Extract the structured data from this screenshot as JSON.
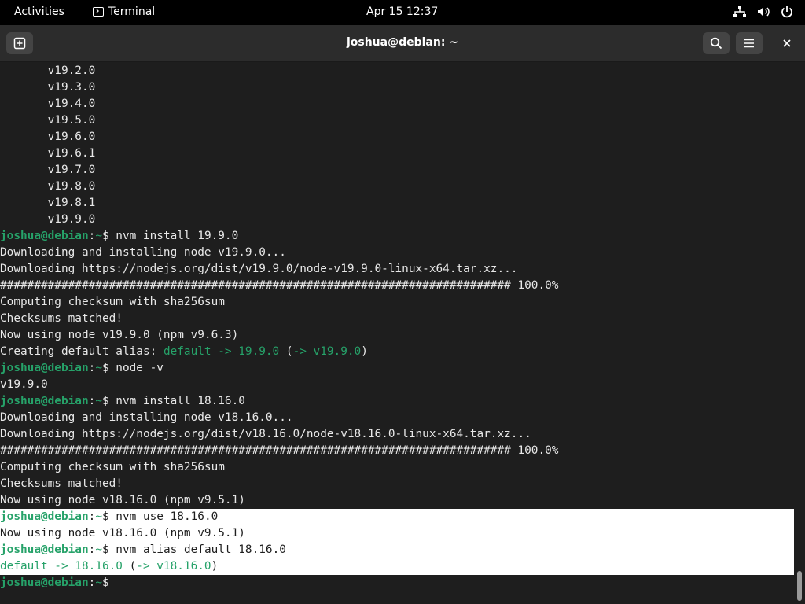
{
  "topbar": {
    "activities": "Activities",
    "app_name": "Terminal",
    "clock": "Apr 15  12:37"
  },
  "window": {
    "title": "joshua@debian: ~"
  },
  "terminal": {
    "lines": [
      [
        {
          "t": "       v19.2.0"
        }
      ],
      [
        {
          "t": "       v19.3.0"
        }
      ],
      [
        {
          "t": "       v19.4.0"
        }
      ],
      [
        {
          "t": "       v19.5.0"
        }
      ],
      [
        {
          "t": "       v19.6.0"
        }
      ],
      [
        {
          "t": "       v19.6.1"
        }
      ],
      [
        {
          "t": "       v19.7.0"
        }
      ],
      [
        {
          "t": "       v19.8.0"
        }
      ],
      [
        {
          "t": "       v19.8.1"
        }
      ],
      [
        {
          "t": "       v19.9.0"
        }
      ],
      [
        {
          "t": "joshua@debian",
          "c": "usr"
        },
        {
          "t": ":"
        },
        {
          "t": "~",
          "c": "grn"
        },
        {
          "t": "$ nvm install 19.9.0"
        }
      ],
      [
        {
          "t": "Downloading and installing node v19.9.0..."
        }
      ],
      [
        {
          "t": "Downloading https://nodejs.org/dist/v19.9.0/node-v19.9.0-linux-x64.tar.xz..."
        }
      ],
      [
        {
          "t": "########################################################################### 100.0%"
        }
      ],
      [
        {
          "t": "Computing checksum with sha256sum"
        }
      ],
      [
        {
          "t": "Checksums matched!"
        }
      ],
      [
        {
          "t": "Now using node v19.9.0 (npm v9.6.3)"
        }
      ],
      [
        {
          "t": "Creating default alias: "
        },
        {
          "t": "default -> 19.9.0",
          "c": "grn"
        },
        {
          "t": " ("
        },
        {
          "t": "-> v19.9.0",
          "c": "grn"
        },
        {
          "t": ")"
        }
      ],
      [
        {
          "t": "joshua@debian",
          "c": "usr"
        },
        {
          "t": ":"
        },
        {
          "t": "~",
          "c": "grn"
        },
        {
          "t": "$ node -v"
        }
      ],
      [
        {
          "t": "v19.9.0"
        }
      ],
      [
        {
          "t": "joshua@debian",
          "c": "usr"
        },
        {
          "t": ":"
        },
        {
          "t": "~",
          "c": "grn"
        },
        {
          "t": "$ nvm install 18.16.0"
        }
      ],
      [
        {
          "t": "Downloading and installing node v18.16.0..."
        }
      ],
      [
        {
          "t": "Downloading https://nodejs.org/dist/v18.16.0/node-v18.16.0-linux-x64.tar.xz..."
        }
      ],
      [
        {
          "t": "########################################################################### 100.0%"
        }
      ],
      [
        {
          "t": "Computing checksum with sha256sum"
        }
      ],
      [
        {
          "t": "Checksums matched!"
        }
      ],
      [
        {
          "t": "Now using node v18.16.0 (npm v9.5.1)"
        }
      ],
      [
        {
          "t": "joshua@debian",
          "c": "usr"
        },
        {
          "t": ":"
        },
        {
          "t": "~",
          "c": "grn"
        },
        {
          "t": "$ nvm use 18.16.0"
        }
      ],
      [
        {
          "t": "Now using node v18.16.0 (npm v9.5.1)"
        }
      ],
      [
        {
          "t": "joshua@debian",
          "c": "usr"
        },
        {
          "t": ":"
        },
        {
          "t": "~",
          "c": "grn"
        },
        {
          "t": "$ nvm alias default 18.16.0"
        }
      ],
      [
        {
          "t": "default -> 18.16.0",
          "c": "grn"
        },
        {
          "t": " ("
        },
        {
          "t": "-> v18.16.0",
          "c": "grn"
        },
        {
          "t": ")"
        }
      ],
      [
        {
          "t": "joshua@debian",
          "c": "usr"
        },
        {
          "t": ":"
        },
        {
          "t": "~",
          "c": "grn"
        },
        {
          "t": "$ "
        }
      ]
    ],
    "selected_from_line": 27,
    "selected_to_line": 30
  },
  "colors": {
    "terminal_bg": "#1e1e1e",
    "prompt_green": "#26a269",
    "selection_bg": "#ffffff"
  }
}
